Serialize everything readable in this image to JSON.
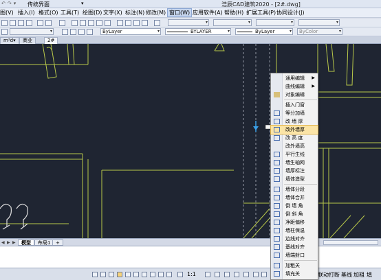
{
  "titlebar": {
    "workspace": "传统界面",
    "title": "浩辰CAD建筑2020 - [2#.dwg]"
  },
  "menubar": {
    "items": [
      "图(V)",
      "插入(I)",
      "格式(O)",
      "工具(T)",
      "绘图(D)",
      "文字(X)",
      "标注(N)",
      "修改(M)",
      "窗口(W)",
      "应用软件(A)",
      "帮助(H)",
      "扩展工具(P)",
      "协同设计(J)"
    ]
  },
  "toolbar": {
    "layer_select": "ByLayer",
    "linetype_select": "BYLAYER",
    "lineweight_select": "ByLayer",
    "color_select": "ByColor"
  },
  "file_tabs": [
    "m²d▾",
    "商业",
    "2#"
  ],
  "layout_tabs": [
    "模型",
    "布局1",
    "+"
  ],
  "context_menu": {
    "items": [
      {
        "label": "通用编辑",
        "sub": true
      },
      {
        "label": "曲线编辑",
        "sub": true
      },
      {
        "label": "对象编辑"
      },
      {
        "label": "插入门窗"
      },
      {
        "label": "等分加墙"
      },
      {
        "label": "改 墙 厚"
      },
      {
        "label": "改外墙厚",
        "highlighted": true
      },
      {
        "label": "改 高 度"
      },
      {
        "label": "改外墙高"
      },
      {
        "label": "平行生线"
      },
      {
        "label": "墙生轴网"
      },
      {
        "label": "墙厚标注"
      },
      {
        "label": "墙体造型"
      },
      {
        "label": "墙体分段"
      },
      {
        "label": "墙体合并"
      },
      {
        "label": "倒 墙 角"
      },
      {
        "label": "倒 斜 角"
      },
      {
        "label": "净距偏移"
      },
      {
        "label": "墙柱保温"
      },
      {
        "label": "边线对齐"
      },
      {
        "label": "基线对齐"
      },
      {
        "label": "墙端封口"
      },
      {
        "label": "加粗关"
      },
      {
        "label": "填充关"
      }
    ]
  },
  "status": {
    "scale": "1:1",
    "items": [
      "联动",
      "打断",
      "基线",
      "加粗",
      "填"
    ]
  },
  "colors": {
    "canvas": "#1f2532",
    "wall_line": "#b9c94a",
    "grid_line": "#c4c9d4",
    "menu_highlight": "#fbe4a6",
    "cursor": "#3aa0e8"
  }
}
